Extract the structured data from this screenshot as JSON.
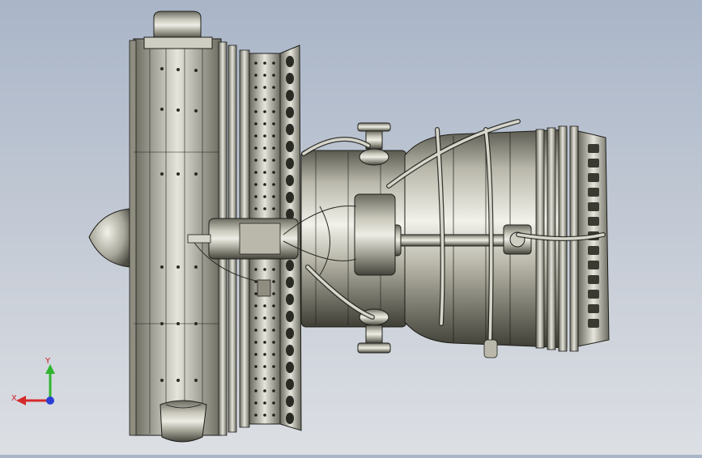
{
  "viewport": {
    "model": "jet-engine-assembly",
    "background_top": "#a9b5c8",
    "background_bottom": "#dcdfe4",
    "metal_dark": "#4a4a40",
    "metal_mid": "#a9a89a",
    "metal_light": "#e6e5dc",
    "edge_color": "#1e1e1a"
  },
  "triad": {
    "x_label": "X",
    "y_label": "Y",
    "x_color": "#d42a2a",
    "y_color": "#2fb52f",
    "z_color": "#2a3fd4"
  }
}
